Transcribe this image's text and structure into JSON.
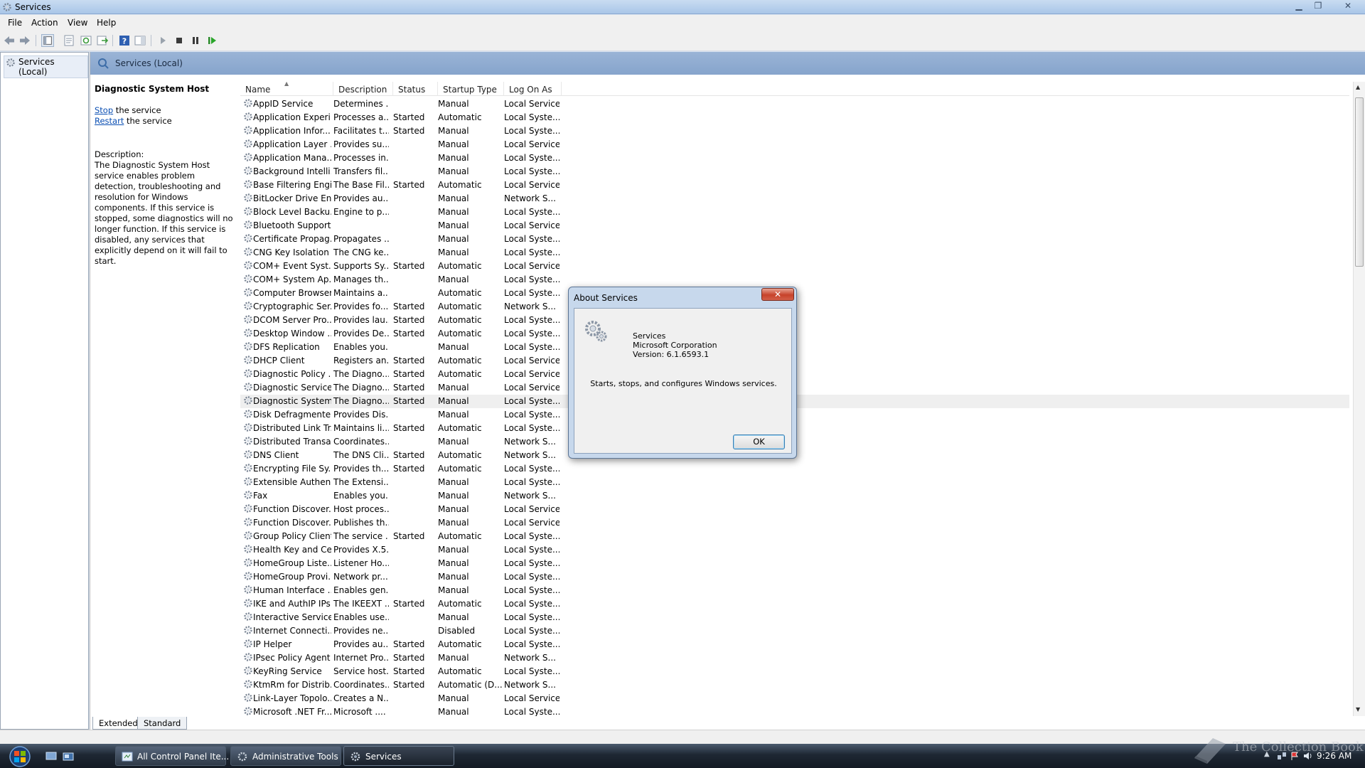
{
  "window": {
    "title": "Services",
    "icon": "gear-icon",
    "controls": [
      "minimize-icon",
      "restore-icon",
      "close-icon"
    ]
  },
  "menu": [
    "File",
    "Action",
    "View",
    "Help"
  ],
  "toolbar": {
    "icons": [
      "back-arrow-icon",
      "forward-arrow-icon",
      "show-hide-console-tree-icon",
      "properties-icon",
      "refresh-icon",
      "export-list-icon",
      "help-icon",
      "show-hide-action-pane-icon",
      "start-service-icon",
      "stop-service-icon",
      "pause-service-icon",
      "restart-service-icon"
    ]
  },
  "tree": {
    "root": "Services (Local)"
  },
  "main": {
    "header": "Services (Local)",
    "selected_service": "Diagnostic System Host",
    "actions": [
      {
        "link": "Stop",
        "rest": " the service"
      },
      {
        "link": "Restart",
        "rest": " the service"
      }
    ],
    "description_label": "Description:",
    "description": "The Diagnostic System Host service enables problem detection, troubleshooting and resolution for Windows components.  If this service is stopped, some diagnostics will no longer function. If this service is disabled, any services that explicitly depend on it will fail to start."
  },
  "columns": [
    "Name",
    "Description",
    "Status",
    "Startup Type",
    "Log On As"
  ],
  "services": [
    [
      "AppID Service",
      "Determines ...",
      "",
      "Manual",
      "Local Service"
    ],
    [
      "Application Experi...",
      "Processes a...",
      "Started",
      "Automatic",
      "Local Syste..."
    ],
    [
      "Application Infor...",
      "Facilitates t...",
      "Started",
      "Manual",
      "Local Syste..."
    ],
    [
      "Application Layer ...",
      "Provides su...",
      "",
      "Manual",
      "Local Service"
    ],
    [
      "Application Mana...",
      "Processes in...",
      "",
      "Manual",
      "Local Syste..."
    ],
    [
      "Background Intelli...",
      "Transfers fil...",
      "",
      "Manual",
      "Local Syste..."
    ],
    [
      "Base Filtering Engi...",
      "The Base Fil...",
      "Started",
      "Automatic",
      "Local Service"
    ],
    [
      "BitLocker Drive En...",
      "Provides au...",
      "",
      "Manual",
      "Network S..."
    ],
    [
      "Block Level Backu...",
      "Engine to p...",
      "",
      "Manual",
      "Local Syste..."
    ],
    [
      "Bluetooth Support...",
      "",
      "",
      "Manual",
      "Local Service"
    ],
    [
      "Certificate Propag...",
      "Propagates ...",
      "",
      "Manual",
      "Local Syste..."
    ],
    [
      "CNG Key Isolation",
      "The CNG ke...",
      "",
      "Manual",
      "Local Syste..."
    ],
    [
      "COM+ Event Syst...",
      "Supports Sy...",
      "Started",
      "Automatic",
      "Local Service"
    ],
    [
      "COM+ System Ap...",
      "Manages th...",
      "",
      "Manual",
      "Local Syste..."
    ],
    [
      "Computer Browser",
      "Maintains a...",
      "",
      "Automatic",
      "Local Syste..."
    ],
    [
      "Cryptographic Ser...",
      "Provides fo...",
      "Started",
      "Automatic",
      "Network S..."
    ],
    [
      "DCOM Server Pro...",
      "Provides lau...",
      "Started",
      "Automatic",
      "Local Syste..."
    ],
    [
      "Desktop Window ...",
      "Provides De...",
      "Started",
      "Automatic",
      "Local Syste..."
    ],
    [
      "DFS Replication",
      "Enables you...",
      "",
      "Manual",
      "Local Syste..."
    ],
    [
      "DHCP Client",
      "Registers an...",
      "Started",
      "Automatic",
      "Local Service"
    ],
    [
      "Diagnostic Policy ...",
      "The Diagno...",
      "Started",
      "Automatic",
      "Local Service"
    ],
    [
      "Diagnostic Service...",
      "The Diagno...",
      "Started",
      "Manual",
      "Local Service"
    ],
    [
      "Diagnostic System...",
      "The Diagno...",
      "Started",
      "Manual",
      "Local Syste..."
    ],
    [
      "Disk Defragmenter",
      "Provides Dis...",
      "",
      "Manual",
      "Local Syste..."
    ],
    [
      "Distributed Link Tr...",
      "Maintains li...",
      "Started",
      "Automatic",
      "Local Syste..."
    ],
    [
      "Distributed Transa...",
      "Coordinates...",
      "",
      "Manual",
      "Network S..."
    ],
    [
      "DNS Client",
      "The DNS Cli...",
      "Started",
      "Automatic",
      "Network S..."
    ],
    [
      "Encrypting File Sy...",
      "Provides th...",
      "Started",
      "Automatic",
      "Local Syste..."
    ],
    [
      "Extensible Authen...",
      "The Extensi...",
      "",
      "Manual",
      "Local Syste..."
    ],
    [
      "Fax",
      "Enables you...",
      "",
      "Manual",
      "Network S..."
    ],
    [
      "Function Discover...",
      "Host proces...",
      "",
      "Manual",
      "Local Service"
    ],
    [
      "Function Discover...",
      "Publishes th...",
      "",
      "Manual",
      "Local Service"
    ],
    [
      "Group Policy Client",
      "The service ...",
      "Started",
      "Automatic",
      "Local Syste..."
    ],
    [
      "Health Key and Ce...",
      "Provides X.5...",
      "",
      "Manual",
      "Local Syste..."
    ],
    [
      "HomeGroup Liste...",
      "Listener Ho...",
      "",
      "Manual",
      "Local Syste..."
    ],
    [
      "HomeGroup Provi...",
      "Network pr...",
      "",
      "Manual",
      "Local Syste..."
    ],
    [
      "Human Interface ...",
      "Enables gen...",
      "",
      "Manual",
      "Local Syste..."
    ],
    [
      "IKE and AuthIP IPs...",
      "The IKEEXT ...",
      "Started",
      "Automatic",
      "Local Syste..."
    ],
    [
      "Interactive Service...",
      "Enables use...",
      "",
      "Manual",
      "Local Syste..."
    ],
    [
      "Internet Connecti...",
      "Provides ne...",
      "",
      "Disabled",
      "Local Syste..."
    ],
    [
      "IP Helper",
      "Provides au...",
      "Started",
      "Automatic",
      "Local Syste..."
    ],
    [
      "IPsec Policy Agent",
      "Internet Pro...",
      "Started",
      "Manual",
      "Network S..."
    ],
    [
      "KeyRing Service",
      "Service host...",
      "Started",
      "Automatic",
      "Local Syste..."
    ],
    [
      "KtmRm for Distrib...",
      "Coordinates...",
      "Started",
      "Automatic (D...",
      "Network S..."
    ],
    [
      "Link-Layer Topolo...",
      "Creates a N...",
      "",
      "Manual",
      "Local Service"
    ],
    [
      "Microsoft .NET Fr...",
      "Microsoft ....",
      "",
      "Manual",
      "Local Syste..."
    ]
  ],
  "selected_row": 22,
  "tabs": [
    "Extended",
    "Standard"
  ],
  "dialog": {
    "title": "About Services",
    "name": "Services",
    "company": "Microsoft Corporation",
    "version": "Version: 6.1.6593.1",
    "message": "Starts, stops, and configures Windows services.",
    "ok": "OK",
    "close": "✕"
  },
  "taskbar": {
    "tasks": [
      "All Control Panel Ite...",
      "Administrative Tools",
      "Services"
    ],
    "active_task": 2,
    "clock": "9:26 AM",
    "watermark": "The Collection Book"
  }
}
